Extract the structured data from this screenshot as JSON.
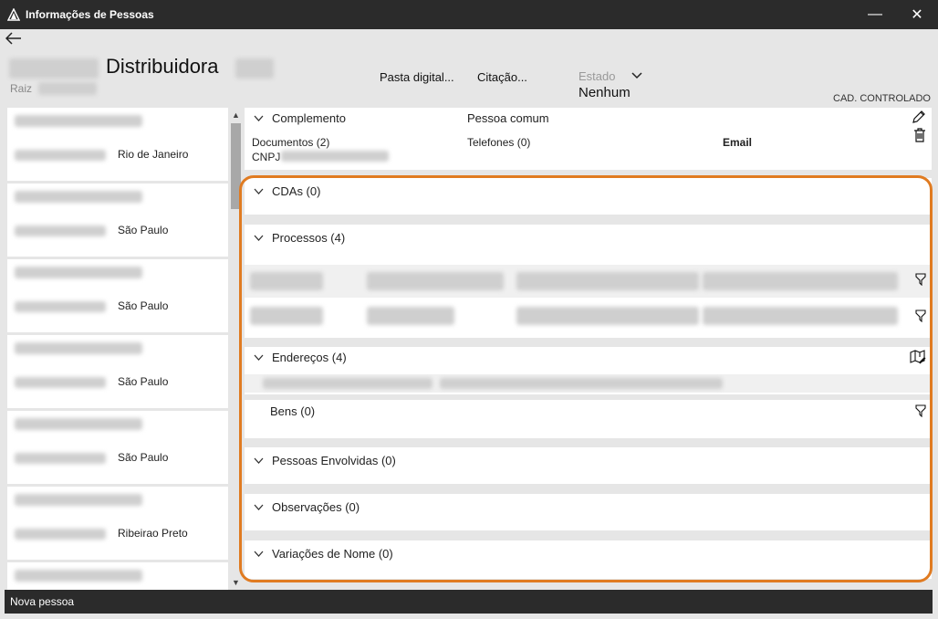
{
  "window": {
    "title": "Informações de Pessoas",
    "minimize": "—",
    "close": "✕"
  },
  "header": {
    "name": "Distribuidora",
    "raiz_label": "Raiz",
    "links": [
      "Pasta digital...",
      "Citação..."
    ],
    "estado_label": "Estado",
    "estado_value": "Nenhum",
    "cad_label": "CAD. CONTROLADO"
  },
  "left_list": {
    "cities": [
      "Rio de Janeiro",
      "São Paulo",
      "São Paulo",
      "São Paulo",
      "São Paulo",
      "Ribeirao Preto",
      ""
    ]
  },
  "complemento": {
    "title": "Complemento",
    "tipo": "Pessoa comum",
    "documentos": "Documentos (2)",
    "telefones": "Telefones (0)",
    "email": "Email",
    "cnpj": "CNPJ"
  },
  "sections": {
    "cdas": "CDAs (0)",
    "processos": "Processos (4)",
    "enderecos": "Endereços (4)",
    "bens": "Bens (0)",
    "pessoas": "Pessoas Envolvidas (0)",
    "observacoes": "Observações (0)",
    "variacoes": "Variações de Nome (0)"
  },
  "statusbar": {
    "new_person": "Nova pessoa"
  },
  "colors": {
    "highlight": "#e07b21",
    "titlebar": "#2b2b2b"
  }
}
